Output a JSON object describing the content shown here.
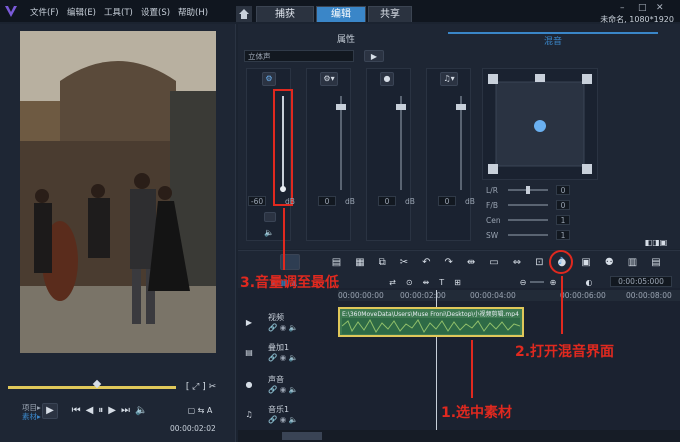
{
  "menu": {
    "file": "文件(F)",
    "edit": "编辑(E)",
    "tools": "工具(T)",
    "settings": "设置(S)",
    "help": "帮助(H)"
  },
  "nav_tabs": {
    "capture": "捕获",
    "edit": "编辑",
    "share": "共享"
  },
  "window_title": "未命名, 1080*1920",
  "mixer": {
    "tab_properties": "属性",
    "tab_mixer": "混音",
    "mode_select": "立体声",
    "db_value": "-60",
    "db_unit": "dB",
    "zero_values": [
      "0",
      "0",
      "0"
    ],
    "surround": {
      "lr_label": "L/R",
      "fb_label": "F/B",
      "cen_label": "Cen",
      "sw_label": "SW",
      "lr_value": "0",
      "fb_value": "0",
      "cen_value": "1",
      "sw_value": "1"
    }
  },
  "player": {
    "mode_project": "项目▸",
    "mode_clip": "素材▸",
    "timecode": "00:00:02:02"
  },
  "timeline": {
    "timecode": "0:00:05:000",
    "ruler": [
      "00:00:00:00",
      "00:00:02:00",
      "00:00:04:00",
      "00:00:06:00",
      "00:00:08:00"
    ],
    "tracks": {
      "video": "视频",
      "overlay": "叠加1",
      "voice": "声音",
      "music": "音乐1"
    },
    "clip_name": "E:\\360MoveData\\Users\\Muse Froni\\Desktop\\小视频剪辑.mp4"
  },
  "annotations": {
    "step1": "1.选中素材",
    "step2": "2.打开混音界面",
    "step3": "3.音量调至最低"
  },
  "colors": {
    "accent": "#3a86c8",
    "annotation": "#e0291f",
    "clip": "#8fbf6a"
  }
}
